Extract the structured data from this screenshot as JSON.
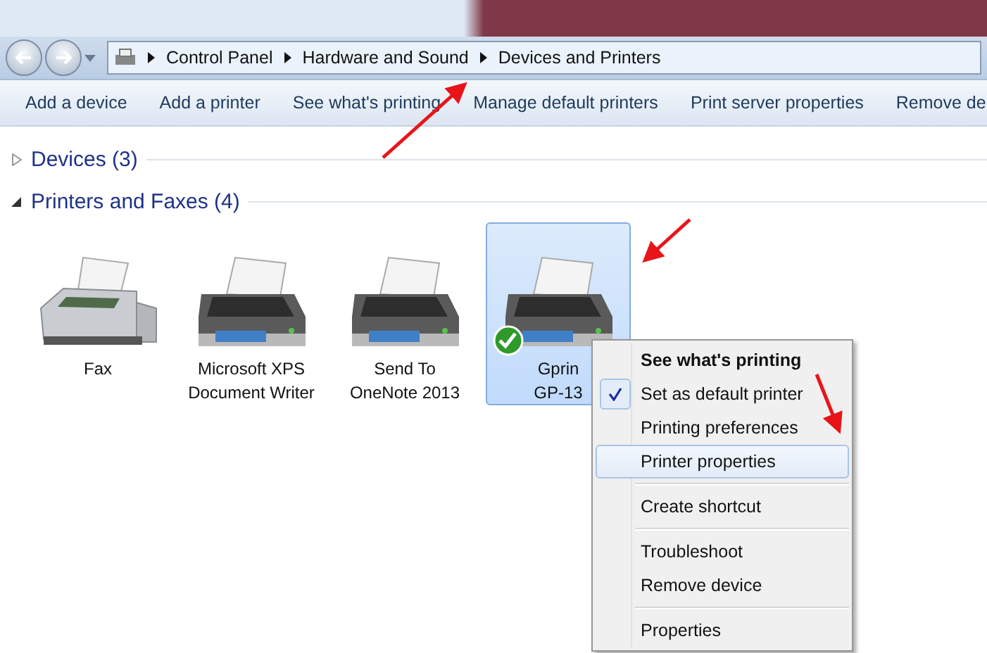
{
  "breadcrumb": [
    "Control Panel",
    "Hardware and Sound",
    "Devices and Printers"
  ],
  "toolbar": [
    "Add a device",
    "Add a printer",
    "See what's printing",
    "Manage default printers",
    "Print server properties",
    "Remove de"
  ],
  "groups": [
    {
      "label": "Devices (3)",
      "expanded": false
    },
    {
      "label": "Printers and Faxes (4)",
      "expanded": true
    }
  ],
  "devices": [
    {
      "kind": "fax",
      "lines": [
        "Fax"
      ],
      "selected": false,
      "default": false
    },
    {
      "kind": "printer",
      "lines": [
        "Microsoft XPS",
        "Document Writer"
      ],
      "selected": false,
      "default": false
    },
    {
      "kind": "printer",
      "lines": [
        "Send To",
        "OneNote 2013"
      ],
      "selected": false,
      "default": false
    },
    {
      "kind": "printer",
      "lines": [
        "Gprin",
        "GP-13"
      ],
      "selected": true,
      "default": true
    }
  ],
  "context_menu": [
    {
      "kind": "item",
      "label": "See what's printing",
      "bold": true,
      "checked": false,
      "highlighted": false
    },
    {
      "kind": "item",
      "label": "Set as default printer",
      "bold": false,
      "checked": true,
      "highlighted": false
    },
    {
      "kind": "item",
      "label": "Printing preferences",
      "bold": false,
      "checked": false,
      "highlighted": false
    },
    {
      "kind": "item",
      "label": "Printer properties",
      "bold": false,
      "checked": false,
      "highlighted": true
    },
    {
      "kind": "separator"
    },
    {
      "kind": "item",
      "label": "Create shortcut",
      "bold": false,
      "checked": false,
      "highlighted": false
    },
    {
      "kind": "separator"
    },
    {
      "kind": "item",
      "label": "Troubleshoot",
      "bold": false,
      "checked": false,
      "highlighted": false
    },
    {
      "kind": "item",
      "label": "Remove device",
      "bold": false,
      "checked": false,
      "highlighted": false
    },
    {
      "kind": "separator"
    },
    {
      "kind": "item",
      "label": "Properties",
      "bold": false,
      "checked": false,
      "highlighted": false
    }
  ]
}
